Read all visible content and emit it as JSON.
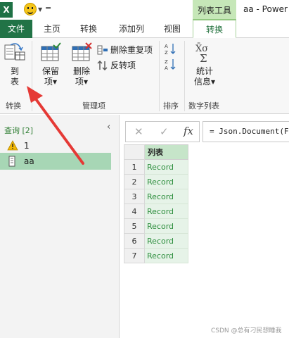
{
  "titlebar": {
    "logo": "X",
    "qat_more": "=",
    "context_group": "列表工具",
    "window_title": "aa - Power"
  },
  "tabs": [
    "文件",
    "主页",
    "转换",
    "添加列",
    "视图",
    "转换"
  ],
  "ribbon": {
    "to_table_line1": "到",
    "to_table_line2": "表",
    "group_convert": "转换",
    "keep_line1": "保留",
    "keep_line2": "项",
    "remove_line1": "删除",
    "remove_line2": "项",
    "remove_duplicates": "删除重复项",
    "reverse": "反转项",
    "group_manage": "管理项",
    "group_sort": "排序",
    "stats_line1": "统计",
    "stats_line2": "信息",
    "group_numeric": "数字列表",
    "caret": "▾"
  },
  "queries": {
    "header": "查询 [2]",
    "items": [
      {
        "name": "1"
      },
      {
        "name": "aa"
      }
    ]
  },
  "formula": {
    "cancel_icon": "✕",
    "commit_icon": "✓",
    "fx": "fx",
    "text": "= Json.Document(F"
  },
  "grid": {
    "column": "列表",
    "rows": [
      {
        "n": "1",
        "v": "Record"
      },
      {
        "n": "2",
        "v": "Record"
      },
      {
        "n": "3",
        "v": "Record"
      },
      {
        "n": "4",
        "v": "Record"
      },
      {
        "n": "5",
        "v": "Record"
      },
      {
        "n": "6",
        "v": "Record"
      },
      {
        "n": "7",
        "v": "Record"
      }
    ]
  },
  "watermark": "CSDN @总有刁民想睡我",
  "colors": {
    "excel_green": "#217346",
    "context_green": "#c6e7b8",
    "record_green": "#2f8f3f",
    "arrow_red": "#e53935"
  }
}
